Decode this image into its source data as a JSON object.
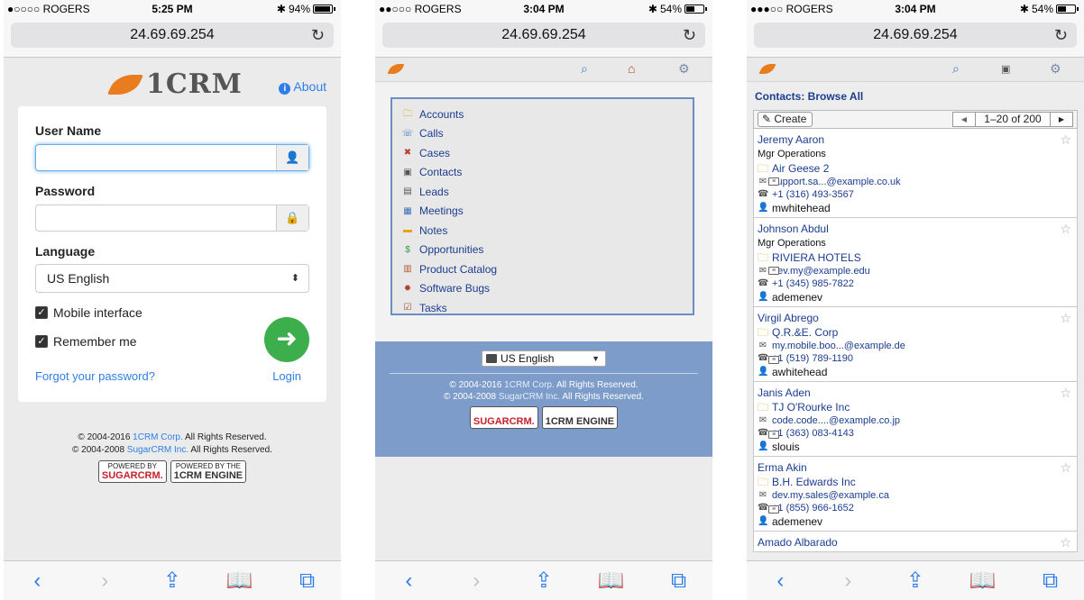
{
  "phone1": {
    "status": {
      "carrier": "●○○○○ ROGERS",
      "time": "5:25 PM",
      "battery": "94%",
      "battery_level": 0.94
    },
    "address": "24.69.69.254",
    "logo_text": "1CRM",
    "about": "About",
    "username_label": "User Name",
    "password_label": "Password",
    "language_label": "Language",
    "language_value": "US English",
    "mobile_interface": "Mobile interface",
    "remember_me": "Remember me",
    "forgot": "Forgot your password?",
    "login": "Login",
    "copyright1_a": "© 2004-2016 ",
    "copyright1_link": "1CRM Corp.",
    "copyright1_b": " All Rights Reserved.",
    "copyright2_a": "© 2004-2008 ",
    "copyright2_link": "SugarCRM Inc.",
    "copyright2_b": " All Rights Reserved.",
    "badge1_top": "POWERED BY",
    "badge1_main": "SUGARCRM.",
    "badge2_top": "POWERED BY THE",
    "badge2_main": "1CRM ENGINE"
  },
  "phone2": {
    "status": {
      "carrier": "●●○○○ ROGERS",
      "time": "3:04 PM",
      "battery": "54%",
      "battery_level": 0.54
    },
    "address": "24.69.69.254",
    "menu": [
      {
        "label": "Accounts",
        "icon": "folder-icon"
      },
      {
        "label": "Calls",
        "icon": "phone-icon"
      },
      {
        "label": "Cases",
        "icon": "tools-icon"
      },
      {
        "label": "Contacts",
        "icon": "contact-card-icon"
      },
      {
        "label": "Leads",
        "icon": "leads-icon"
      },
      {
        "label": "Meetings",
        "icon": "meetings-icon"
      },
      {
        "label": "Notes",
        "icon": "notes-icon"
      },
      {
        "label": "Opportunities",
        "icon": "money-icon"
      },
      {
        "label": "Product Catalog",
        "icon": "catalog-icon"
      },
      {
        "label": "Software Bugs",
        "icon": "bug-icon"
      },
      {
        "label": "Tasks",
        "icon": "tasks-icon"
      }
    ],
    "language_value": "US English",
    "copyright1_a": "© 2004-2016 ",
    "copyright1_link": "1CRM Corp.",
    "copyright1_b": " All Rights Reserved.",
    "copyright2_a": "© 2004-2008 ",
    "copyright2_link": "SugarCRM Inc.",
    "copyright2_b": " All Rights Reserved.",
    "badge1_top": "POWERED BY",
    "badge1_main": "SUGARCRM.",
    "badge2_top": "POWERED BY THE",
    "badge2_main": "1CRM ENGINE"
  },
  "phone3": {
    "status": {
      "carrier": "●●●○○ ROGERS",
      "time": "3:04 PM",
      "battery": "54%",
      "battery_level": 0.54
    },
    "address": "24.69.69.254",
    "title": "Contacts: Browse All",
    "create": "Create",
    "pager_range": "1–20 of 200",
    "contacts": [
      {
        "name": "Jeremy Aaron",
        "title": "Mgr Operations",
        "account": "Air Geese 2",
        "email": "support.sa...@example.co.uk",
        "phone": "+1 (316) 493-3567",
        "user": "mwhitehead"
      },
      {
        "name": "Johnson Abdul",
        "title": "Mgr Operations",
        "account": "RIVIERA HOTELS",
        "email": "dev.my@example.edu",
        "phone": "+1 (345) 985-7822",
        "user": "ademenev"
      },
      {
        "name": "Virgil Abrego",
        "title": "",
        "account": "Q.R.&E. Corp",
        "email": "my.mobile.boo...@example.de",
        "phone": "+1 (519) 789-1190",
        "user": "awhitehead"
      },
      {
        "name": "Janis Aden",
        "title": "",
        "account": "TJ O'Rourke Inc",
        "email": "code.code....@example.co.jp",
        "phone": "+1 (363) 083-4143",
        "user": "slouis"
      },
      {
        "name": "Erma Akin",
        "title": "",
        "account": "B.H. Edwards Inc",
        "email": "dev.my.sales@example.ca",
        "phone": "+1 (855) 966-1652",
        "user": "ademenev"
      },
      {
        "name": "Amado Albarado",
        "title": "",
        "account": "",
        "email": "",
        "phone": "",
        "user": ""
      }
    ]
  },
  "safari_bar": [
    "back-icon",
    "forward-icon",
    "share-icon",
    "bookmarks-icon",
    "tabs-icon"
  ]
}
